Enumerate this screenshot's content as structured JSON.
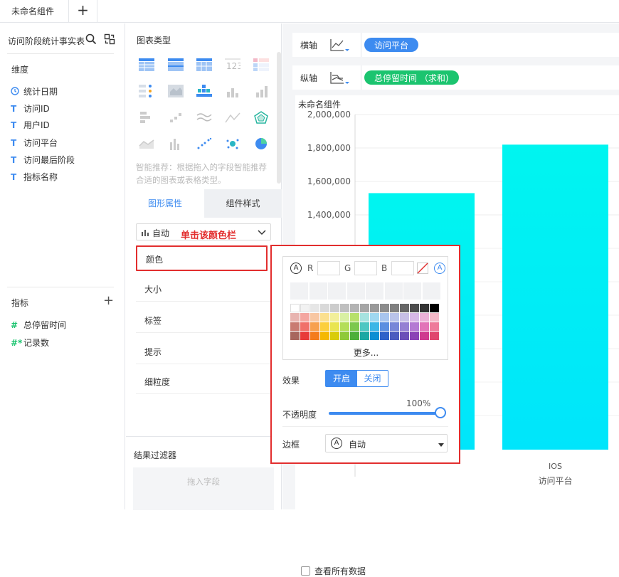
{
  "tabs": {
    "main_label": "未命名组件",
    "add_label": "+"
  },
  "left_panel": {
    "dataset_name": "访问阶段统计事实表",
    "dimension_title": "维度",
    "dimensions": [
      {
        "icon": "clock-icon",
        "label": "统计日期"
      },
      {
        "icon": "text-type-icon",
        "label": "访问ID"
      },
      {
        "icon": "text-type-icon",
        "label": "用户ID"
      },
      {
        "icon": "text-type-icon",
        "label": "访问平台"
      },
      {
        "icon": "text-type-icon",
        "label": "访问最后阶段"
      },
      {
        "icon": "text-type-icon",
        "label": "指标名称"
      }
    ],
    "indicator_title": "指标",
    "indicators": [
      {
        "icon": "hash-icon",
        "label": "总停留时间"
      },
      {
        "icon": "hash-calc-icon",
        "label": "记录数"
      }
    ],
    "glyph_text": "T",
    "glyph_hash": "#",
    "glyph_hash_calc": "#*",
    "add_symbol": "+"
  },
  "mid_panel": {
    "chart_type_title": "图表类型",
    "smart_hint": "智能推荐：根据拖入的字段智能推荐合适的图表或表格类型。",
    "tab_shape": "图形属性",
    "tab_style": "组件样式",
    "auto_select": "自动",
    "props": [
      "颜色",
      "大小",
      "标签",
      "提示",
      "细粒度"
    ],
    "filter_title": "结果过滤器",
    "filter_drop": "拖入字段"
  },
  "annotation": "单击该颜色栏",
  "axes": {
    "x_label": "横轴",
    "x_field": "访问平台",
    "y_label": "纵轴",
    "y_field": "总停留时间 （求和)"
  },
  "colors": {
    "accent": "#3d8bf0",
    "x_pill": "#3d8bf0",
    "y_pill": "#1bc46f",
    "highlight": "#e22e2e",
    "bar_top": "#00f5f0",
    "bar_bottom": "#00e5fb"
  },
  "chart_data": {
    "type": "bar",
    "title": "未命名组件",
    "categories": [
      "",
      "IOS"
    ],
    "values": [
      1530000,
      1820000
    ],
    "xlabel": "访问平台",
    "yticks": [
      "1,400,000",
      "1,600,000",
      "1,800,000",
      "2,000,000"
    ],
    "ylim": [
      0,
      2000000
    ],
    "grid": true
  },
  "color_popup": {
    "r_label": "R",
    "g_label": "G",
    "b_label": "B",
    "auto_glyph": "A",
    "more_label": "更多...",
    "effect_label": "效果",
    "effect_on": "开启",
    "effect_off": "关闭",
    "opacity_label": "不透明度",
    "opacity_value": "100%",
    "border_label": "边框",
    "border_value": "自动",
    "palette": [
      [
        "#ffffff",
        "#f2f2f2",
        "#e6e6e6",
        "#d9d9d9",
        "#cccccc",
        "#bfbfbf",
        "#b3b3b3",
        "#a6a6a6",
        "#999999",
        "#8c8c8c",
        "#808080",
        "#666666",
        "#4d4d4d",
        "#333333",
        "#000000"
      ],
      [
        "#e8b4b0",
        "#f4a6a0",
        "#f8c7a2",
        "#fbe08f",
        "#f2ef9a",
        "#d9f0a3",
        "#b7e06b",
        "#a6e3e0",
        "#9fd8f0",
        "#a8c5ee",
        "#b9c3ea",
        "#c7bfe6",
        "#d7b8e6",
        "#ecb2d8",
        "#f3b9c8"
      ],
      [
        "#c97b72",
        "#f0706a",
        "#f7a04f",
        "#fccf3d",
        "#e9e54f",
        "#b4de59",
        "#7cc84d",
        "#4dc7c2",
        "#3cb6e6",
        "#5b8fe0",
        "#7887d8",
        "#9580d3",
        "#b47ad3",
        "#e274b8",
        "#ee7b9a"
      ],
      [
        "#a8665e",
        "#e83a3a",
        "#f47c1c",
        "#f5b800",
        "#d9cc0a",
        "#8fc93a",
        "#4caf3a",
        "#1aa8a3",
        "#0b8fd3",
        "#2e62c9",
        "#4c5cbf",
        "#6b4fb8",
        "#8b43b6",
        "#cf3a8f",
        "#e0466e"
      ]
    ]
  }
}
